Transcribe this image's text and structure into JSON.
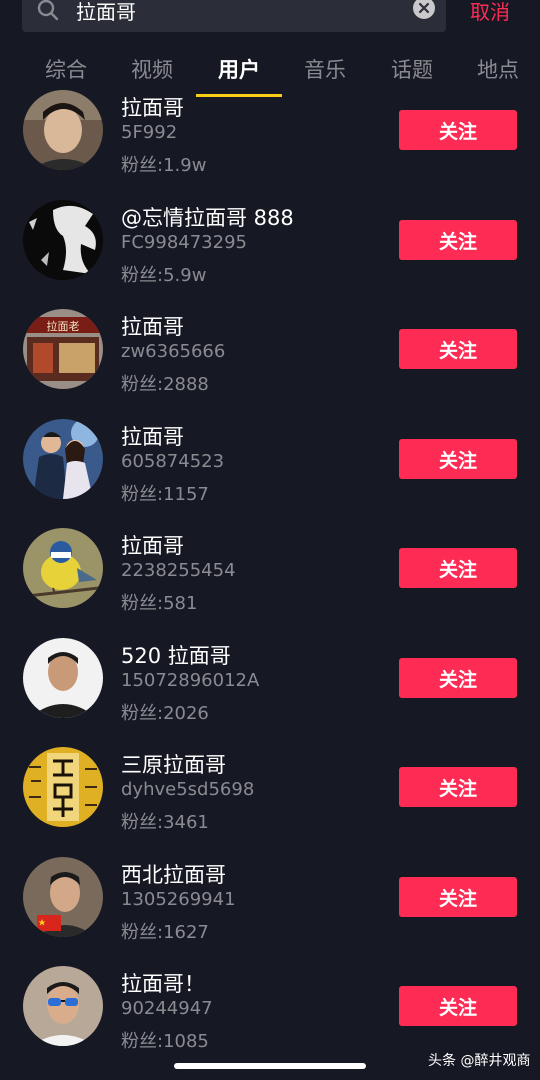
{
  "search": {
    "query": "拉面哥",
    "cancel_label": "取消"
  },
  "tabs": [
    {
      "label": "综合"
    },
    {
      "label": "视频"
    },
    {
      "label": "用户",
      "active": true
    },
    {
      "label": "音乐"
    },
    {
      "label": "话题"
    },
    {
      "label": "地点"
    }
  ],
  "follow_label": "关注",
  "users": [
    {
      "name": "拉面哥",
      "id": "5F992",
      "fans": "粉丝:1.9w",
      "avatar": "portrait-young-man"
    },
    {
      "name": "@忘情拉面哥 888",
      "id": "FC998473295",
      "fans": "粉丝:5.9w",
      "avatar": "black-white-silhouette"
    },
    {
      "name": "拉面哥",
      "id": "zw6365666",
      "fans": "粉丝:2888",
      "avatar": "noodle-shop-storefront"
    },
    {
      "name": "拉面哥",
      "id": "605874523",
      "fans": "粉丝:1157",
      "avatar": "couple-photo"
    },
    {
      "name": "拉面哥",
      "id": "2238255454",
      "fans": "粉丝:581",
      "avatar": "bird-on-branch"
    },
    {
      "name": "520 拉面哥",
      "id": "15072896012A",
      "fans": "粉丝:2026",
      "avatar": "man-portrait"
    },
    {
      "name": "三原拉面哥",
      "id": "dyhve5sd5698",
      "fans": "粉丝:3461",
      "avatar": "calligraphy-biang"
    },
    {
      "name": "西北拉面哥",
      "id": "1305269941",
      "fans": "粉丝:1627",
      "avatar": "man-with-flag"
    },
    {
      "name": "拉面哥！",
      "id": "90244947",
      "fans": "粉丝:1085",
      "avatar": "man-with-sunglasses"
    }
  ],
  "watermark": "头条 @醉井观商",
  "colors": {
    "background": "#161823",
    "accent": "#fe2c55",
    "tab_underline": "#face15",
    "secondary_text": "#8a8b91"
  }
}
